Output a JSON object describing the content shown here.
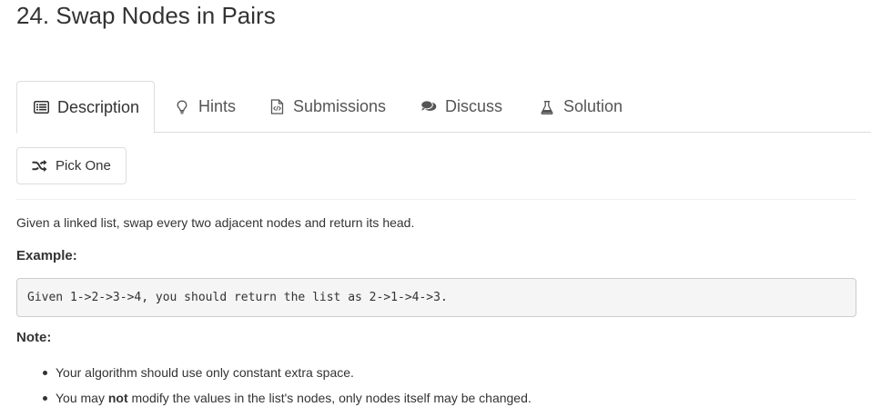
{
  "problem": {
    "title": "24. Swap Nodes in Pairs"
  },
  "tabs": [
    {
      "label": "Description",
      "icon": "description-icon",
      "active": true
    },
    {
      "label": "Hints",
      "icon": "lightbulb-icon",
      "active": false
    },
    {
      "label": "Submissions",
      "icon": "code-file-icon",
      "active": false
    },
    {
      "label": "Discuss",
      "icon": "comments-icon",
      "active": false
    },
    {
      "label": "Solution",
      "icon": "flask-icon",
      "active": false
    }
  ],
  "pick_one": {
    "label": "Pick One",
    "icon": "shuffle-icon"
  },
  "content": {
    "description": "Given a linked list, swap every two adjacent nodes and return its head.",
    "example_heading": "Example:",
    "example_code": "Given 1->2->3->4, you should return the list as 2->1->4->3.",
    "note_heading": "Note:",
    "notes": [
      {
        "text": "Your algorithm should use only constant extra space."
      },
      {
        "prefix": "You may ",
        "emphasis": "not",
        "suffix": " modify the values in the list's nodes, only nodes itself may be changed."
      }
    ]
  },
  "colors": {
    "text": "#333333",
    "tab_text": "#555555",
    "border": "#dddddd",
    "code_bg": "#f5f5f5"
  }
}
